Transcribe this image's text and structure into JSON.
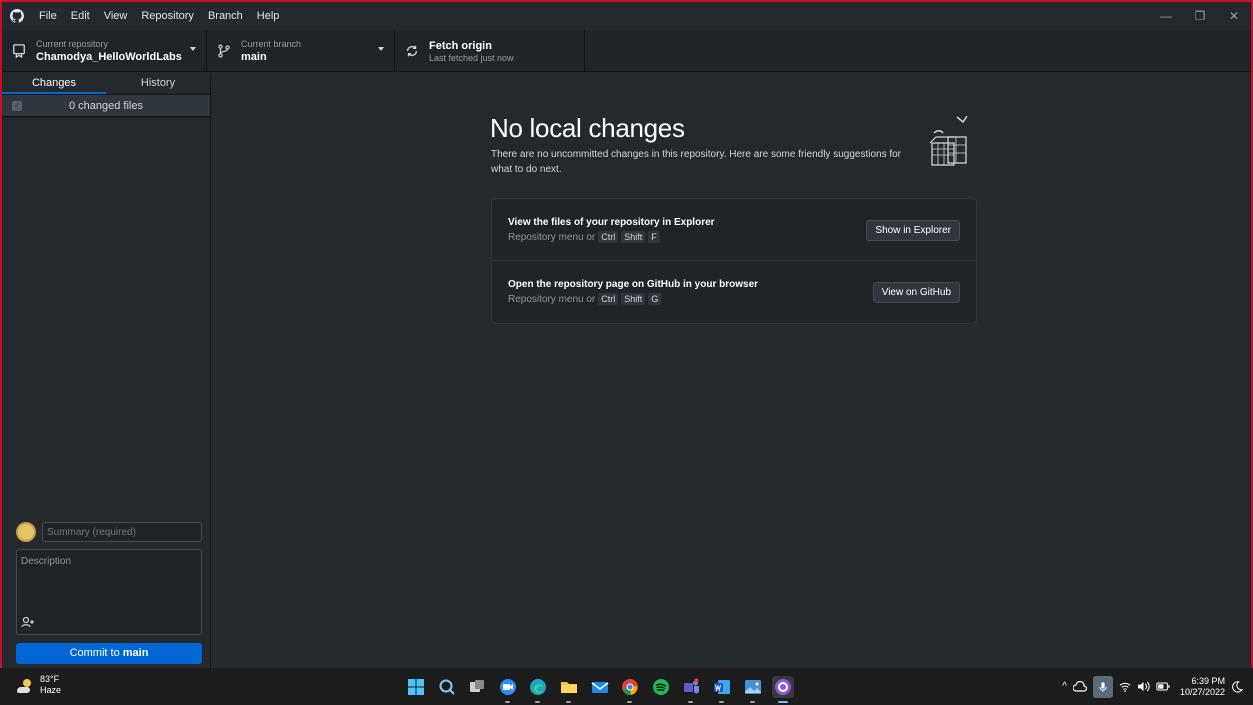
{
  "menu": [
    "File",
    "Edit",
    "View",
    "Repository",
    "Branch",
    "Help"
  ],
  "window_controls": {
    "minimize": "—",
    "restore": "❐",
    "close": "✕"
  },
  "toolbar": {
    "repo_label": "Current repository",
    "repo_value": "Chamodya_HelloWorldLabs",
    "branch_label": "Current branch",
    "branch_value": "main",
    "fetch_title": "Fetch origin",
    "fetch_sub": "Last fetched just now"
  },
  "sidebar": {
    "tabs": [
      "Changes",
      "History"
    ],
    "active_tab": "Changes",
    "changed_count": "0 changed files",
    "summary_placeholder": "Summary (required)",
    "description_placeholder": "Description",
    "commit_prefix": "Commit to ",
    "commit_branch": "main"
  },
  "main": {
    "title": "No local changes",
    "description": "There are no uncommitted changes in this repository. Here are some friendly suggestions for what to do next.",
    "suggestions": [
      {
        "title": "View the files of your repository in Explorer",
        "hint": "Repository menu or",
        "keys": [
          "Ctrl",
          "Shift",
          "F"
        ],
        "button": "Show in Explorer"
      },
      {
        "title": "Open the repository page on GitHub in your browser",
        "hint": "Repository menu or",
        "keys": [
          "Ctrl",
          "Shift",
          "G"
        ],
        "button": "View on GitHub"
      }
    ]
  },
  "taskbar": {
    "weather_temp": "83°F",
    "weather_cond": "Haze",
    "apps": [
      "start-icon",
      "search-icon",
      "task-view-icon",
      "zoom-icon",
      "edge-icon",
      "file-explorer-icon",
      "mail-icon",
      "chrome-icon",
      "spotify-icon",
      "teams-icon",
      "word-icon",
      "photos-icon",
      "github-desktop-icon"
    ],
    "clock_time": "6:39 PM",
    "clock_date": "10/27/2022"
  },
  "colors": {
    "accent": "#0366d6",
    "background": "#24292e",
    "toolbar": "#1f2428",
    "frame": "#c8102e"
  }
}
